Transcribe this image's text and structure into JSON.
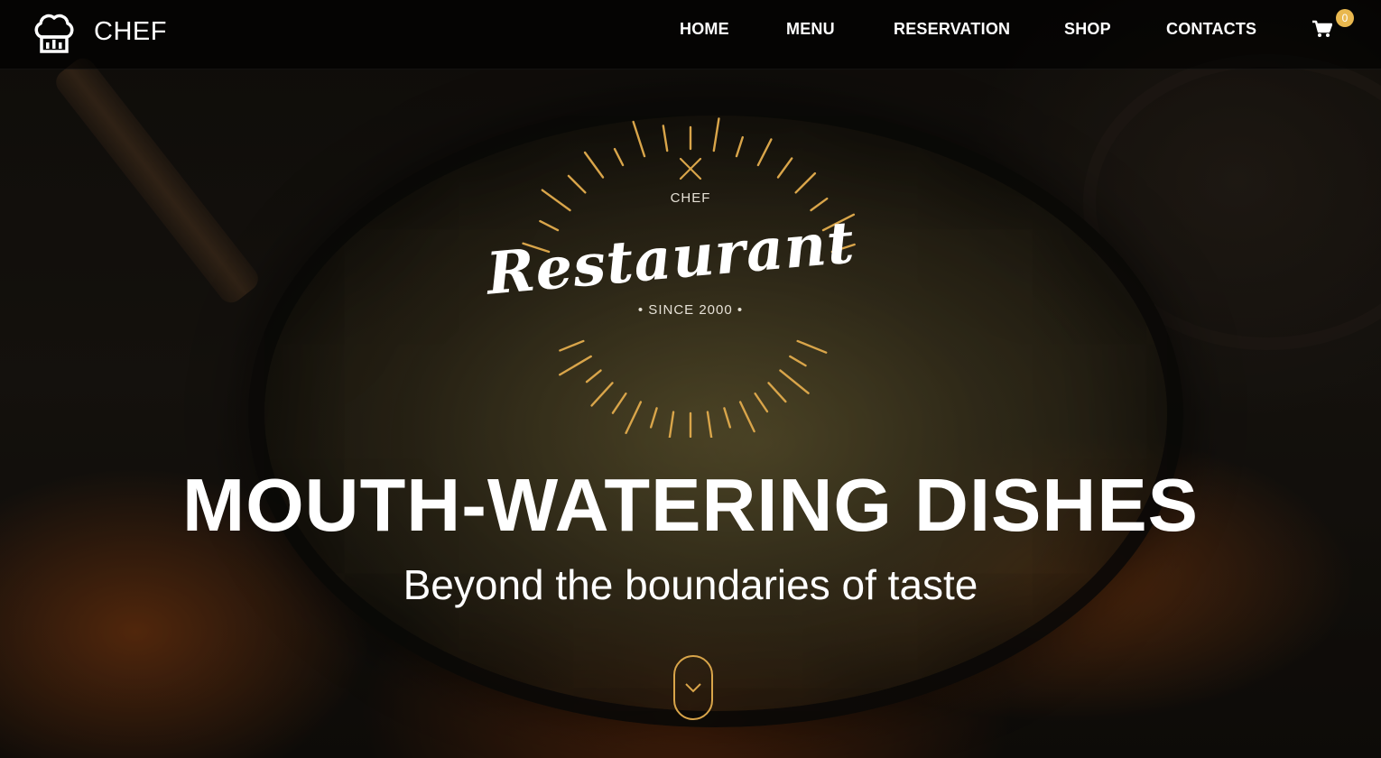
{
  "brand": {
    "name": "CHEF",
    "icon": "chef-hat-icon"
  },
  "nav": {
    "items": [
      "HOME",
      "MENU",
      "RESERVATION",
      "SHOP",
      "CONTACTS"
    ]
  },
  "cart": {
    "icon": "shopping-cart-icon",
    "count": "0"
  },
  "emblem": {
    "top": "CHEF",
    "word": "Restaurant",
    "since": "• SINCE 2000 •",
    "icon": "crossed-cutlery-icon"
  },
  "hero": {
    "headline": "MOUTH-WATERING DISHES",
    "subheadline": "Beyond the boundaries of taste"
  },
  "scroll": {
    "icon": "chevron-down-icon"
  },
  "colors": {
    "accent": "#e9b84f",
    "ray": "#d9a54a",
    "text": "#ffffff"
  }
}
